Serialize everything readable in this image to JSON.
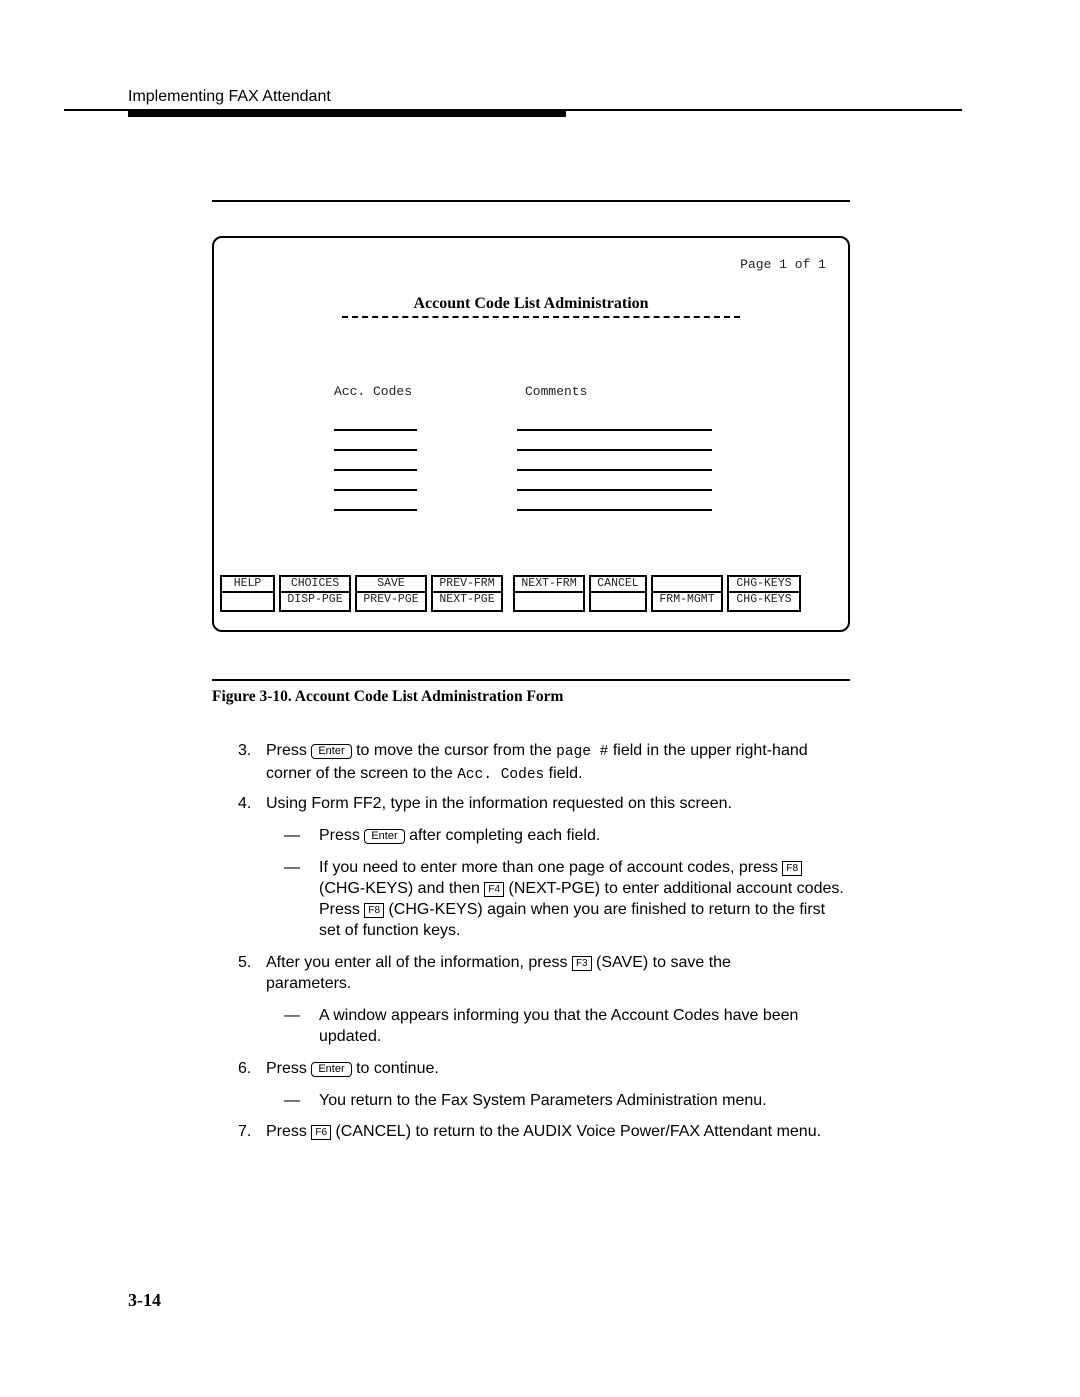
{
  "header": {
    "title": "Implementing FAX Attendant"
  },
  "screen": {
    "page_indicator": "Page 1 of 1",
    "form_title": "Account Code List Administration",
    "columns": {
      "acc_codes": "Acc. Codes",
      "comments": "Comments"
    },
    "rows": 5,
    "function_keys": [
      {
        "top": "HELP",
        "bottom": ""
      },
      {
        "top": "CHOICES",
        "bottom": "DISP-PGE"
      },
      {
        "top": "SAVE",
        "bottom": "PREV-PGE"
      },
      {
        "top": "PREV-FRM",
        "bottom": "NEXT-PGE"
      },
      {
        "top": "NEXT-FRM",
        "bottom": ""
      },
      {
        "top": "CANCEL",
        "bottom": ""
      },
      {
        "top": "",
        "bottom": "FRM-MGMT"
      },
      {
        "top": "CHG-KEYS",
        "bottom": "CHG-KEYS"
      }
    ]
  },
  "caption": "Figure 3-10.  Account Code List Administration Form",
  "steps": {
    "s3": {
      "num": "3.",
      "a": "Press ",
      "key": "Enter",
      "b": " to move the cursor from the ",
      "code1": "page #",
      "c": " field in the upper right-hand corner of the screen to the ",
      "code2": "Acc. Codes",
      "d": " field."
    },
    "s4": {
      "num": "4.",
      "text": "Using Form FF2, type in the information requested on this screen.",
      "sub1": {
        "a": "Press ",
        "key": "Enter",
        "b": " after completing each field."
      },
      "sub2": {
        "a": "If you need to enter more than one page of account codes, press ",
        "k1": "F8",
        "b": " (CHG-KEYS) and then ",
        "k2": "F4",
        "c": " (NEXT-PGE) to enter additional account codes.  Press ",
        "k3": "F8",
        "d": " (CHG-KEYS) again when you are finished to return to the first set of function keys."
      }
    },
    "s5": {
      "num": "5.",
      "a": "After you enter all of the information, press ",
      "key": "F3",
      "b": " (SAVE) to save the parameters.",
      "sub1": "A window appears informing you that the Account Codes have been updated."
    },
    "s6": {
      "num": "6.",
      "a": "Press ",
      "key": "Enter",
      "b": " to continue.",
      "sub1": "You return to the Fax System Parameters Administration menu."
    },
    "s7": {
      "num": "7.",
      "a": "Press ",
      "key": "F6",
      "b": " (CANCEL) to return to the AUDIX Voice Power/FAX Attendant menu."
    },
    "dash": "—"
  },
  "page_number": "3-14"
}
